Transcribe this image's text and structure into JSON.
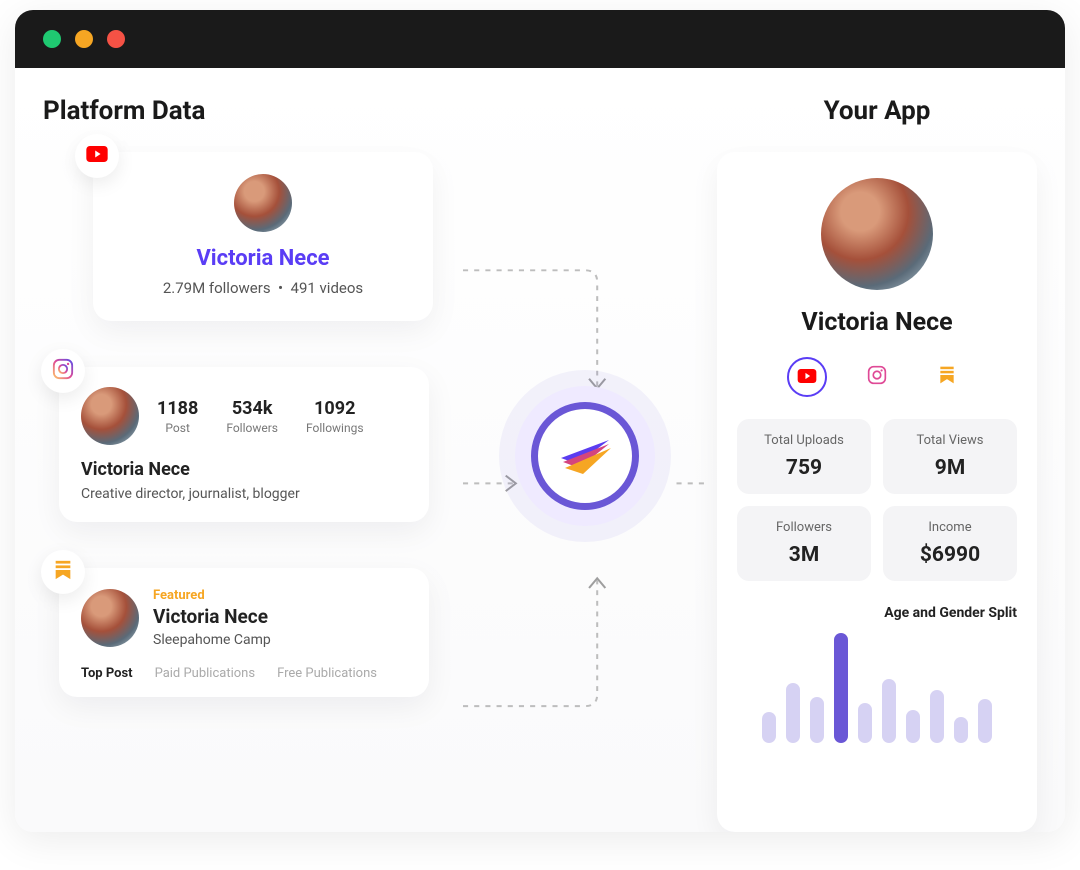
{
  "titles": {
    "left": "Platform Data",
    "right": "Your App"
  },
  "youtube": {
    "name": "Victoria Nece",
    "followers": "2.79M followers",
    "videos": "491 videos"
  },
  "instagram": {
    "posts_value": "1188",
    "posts_label": "Post",
    "followers_value": "534k",
    "followers_label": "Followers",
    "followings_value": "1092",
    "followings_label": "Followings",
    "name": "Victoria Nece",
    "bio": "Creative director, journalist, blogger"
  },
  "substack": {
    "featured_label": "Featured",
    "name": "Victoria Nece",
    "subtitle": "Sleepahome Camp",
    "tabs": {
      "top": "Top Post",
      "paid": "Paid Publications",
      "free": "Free Publications"
    }
  },
  "app": {
    "name": "Victoria Nece",
    "metrics": {
      "uploads_label": "Total Uploads",
      "uploads_value": "759",
      "views_label": "Total Views",
      "views_value": "9M",
      "followers_label": "Followers",
      "followers_value": "3M",
      "income_label": "Income",
      "income_value": "$6990"
    },
    "chart_title": "Age and Gender Split"
  },
  "chart_data": {
    "type": "bar",
    "title": "Age and Gender Split",
    "values": [
      28,
      55,
      42,
      100,
      36,
      58,
      30,
      48,
      24,
      40
    ],
    "highlight_index": 3,
    "note": "bar heights in relative percent of max; no axis labels shown"
  },
  "colors": {
    "accent": "#5a3df5",
    "youtube": "#ff0000",
    "substack": "#f6a623"
  }
}
